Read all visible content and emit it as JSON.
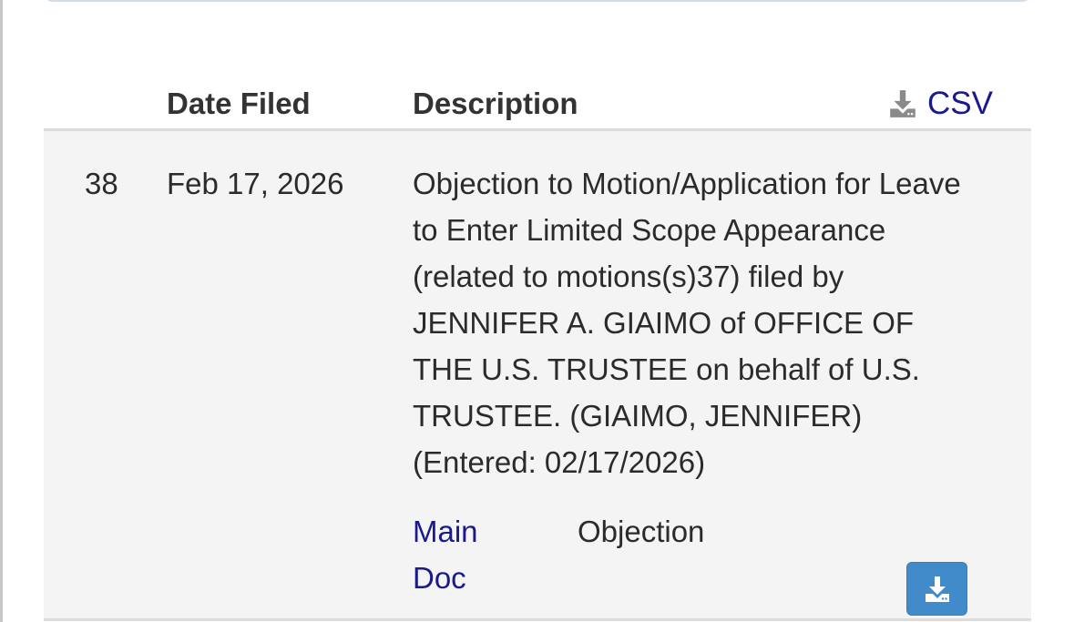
{
  "header": {
    "date_filed": "Date Filed",
    "description": "Description",
    "csv_label": "CSV"
  },
  "entry": {
    "number": "38",
    "date": "Feb 17, 2026",
    "description": "Objection to Motion/Application for Leave to Enter Limited Scope Appearance (related to motions(s)37) filed by JENNIFER A. GIAIMO of OFFICE OF THE U.S. TRUSTEE on behalf of U.S. TRUSTEE. (GIAIMO, JENNIFER) (Entered: 02/17/2026)",
    "doc_link": "Main Doc",
    "doc_type": "Objection"
  },
  "icons": {
    "csv": "download-icon",
    "download_button": "download-icon"
  },
  "colors": {
    "link": "#1a1a8c",
    "button": "#428bca",
    "row_bg": "#f4f4f4"
  }
}
